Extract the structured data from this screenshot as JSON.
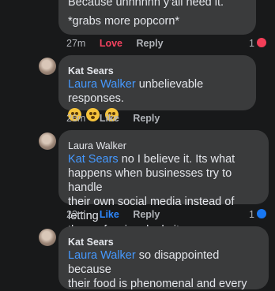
{
  "comments": [
    {
      "text_lines": [
        "Because uhhhhhh y'all need it.",
        "*grabs more popcorn*"
      ],
      "time": "27m",
      "reaction": "Love",
      "reply": "Reply",
      "count": "1",
      "badge_icon": "heart-reaction-icon"
    },
    {
      "author": "Kat Sears",
      "mention": "Laura Walker",
      "text": "unbelievable responses.",
      "emoji_icons": [
        "rofl-emoji-icon",
        "flushed-emoji-icon",
        "flushed-emoji-icon"
      ],
      "time": "26m",
      "reaction": "Like",
      "reply": "Reply"
    },
    {
      "author": "Laura Walker",
      "mention": "Kat Sears",
      "text_lines": [
        " no I believe it. Its what",
        "happens when businesses try to handle",
        "their own social media instead of letting",
        "the professionals do it."
      ],
      "time": "23m",
      "reaction": "Like",
      "reply": "Reply",
      "count": "1",
      "badge_icon": "like-reaction-icon"
    },
    {
      "author": "Kat Sears",
      "mention": "Laura Walker",
      "text_lines": [
        " so disappointed because",
        "their food is phenomenal and every"
      ]
    }
  ],
  "colors": {
    "background": "#18191a",
    "bubble": "#3a3b3c",
    "mention": "#4599ff",
    "love": "#f3425f",
    "like_active": "#2d88ff"
  }
}
